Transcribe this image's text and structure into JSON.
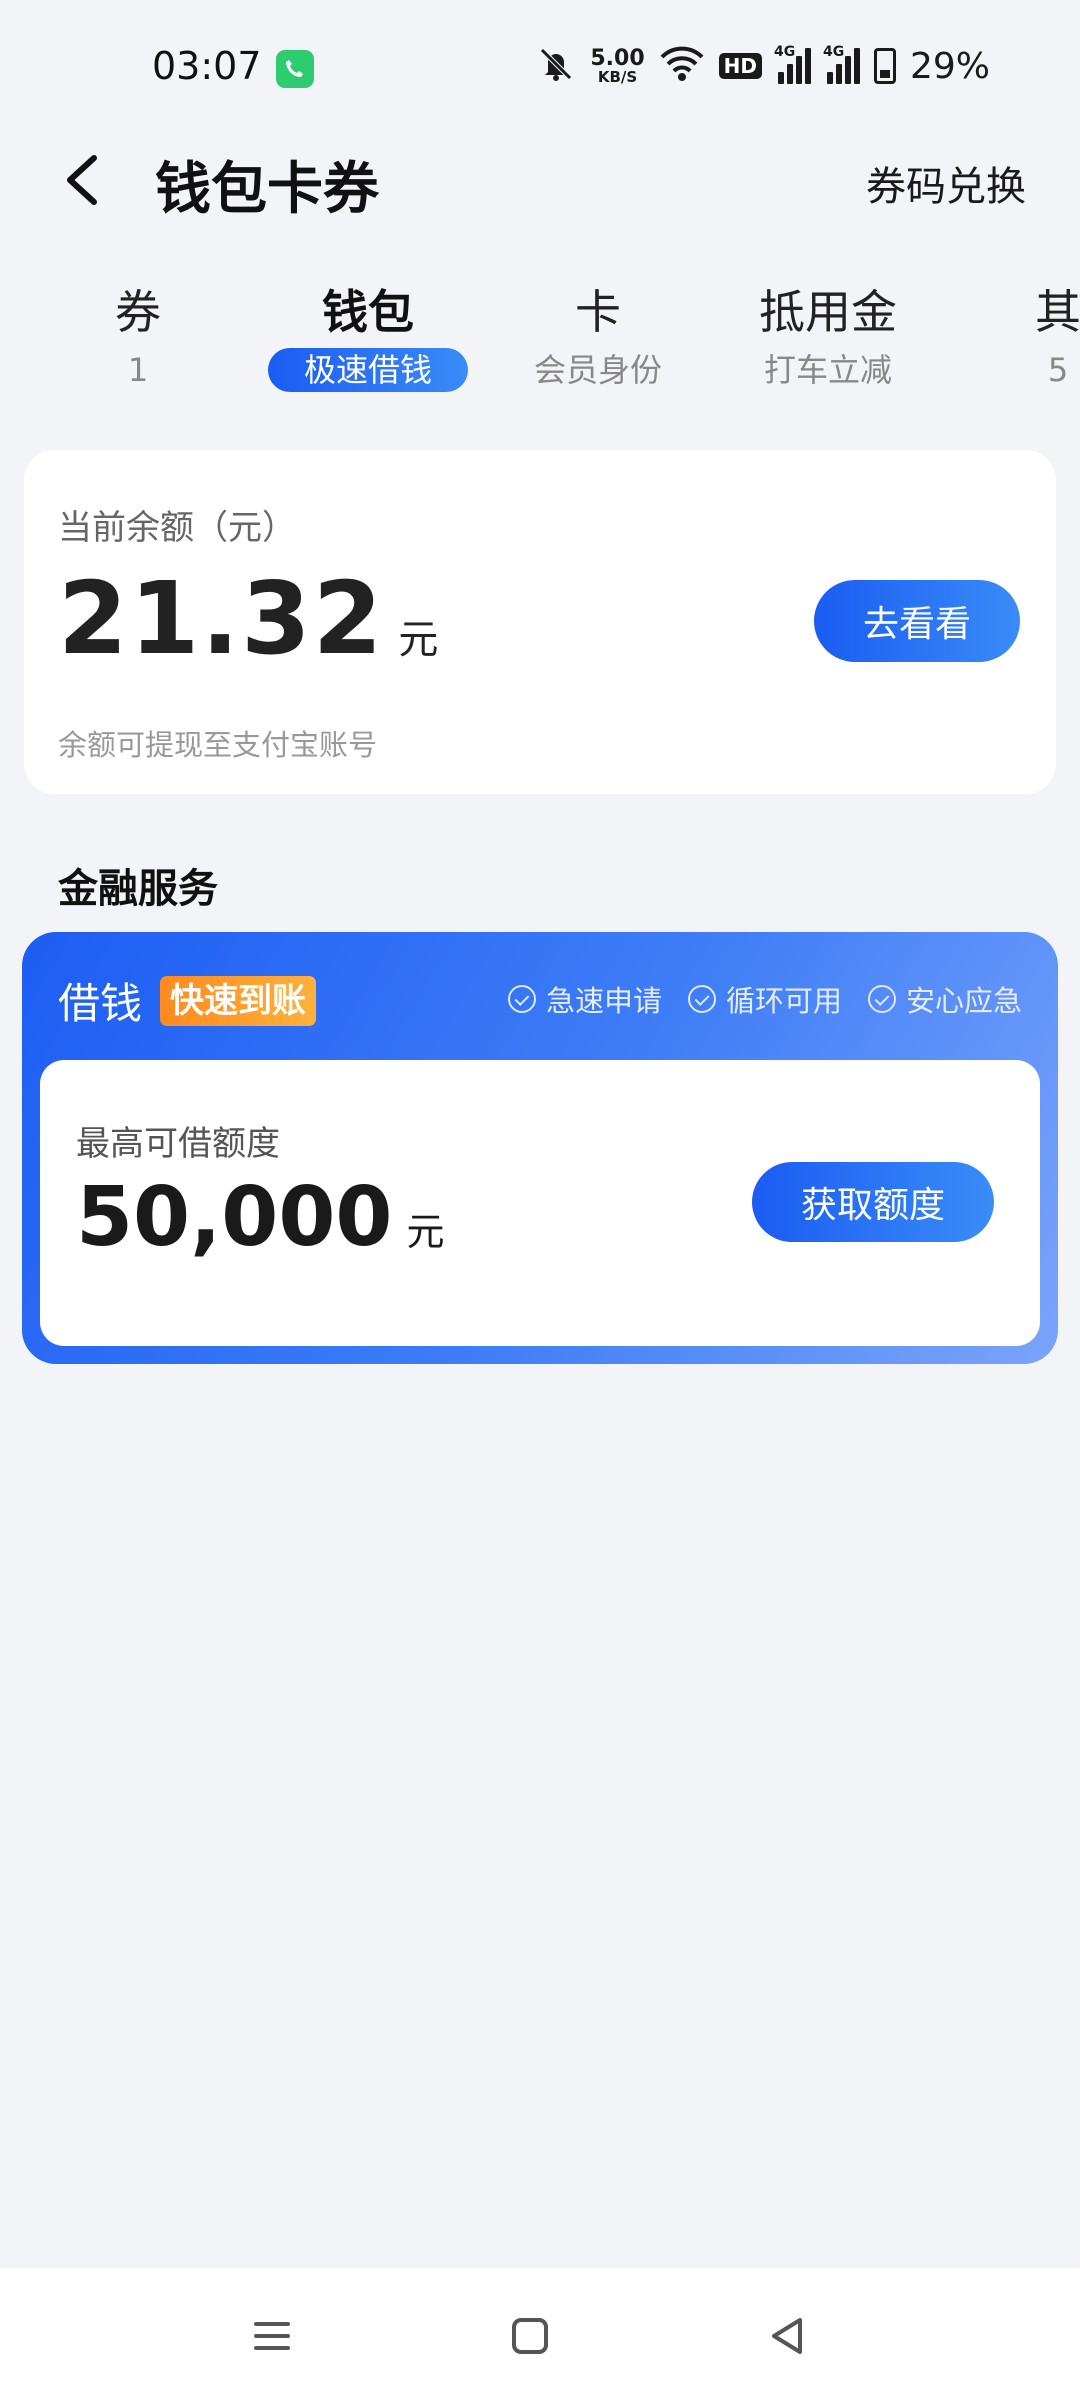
{
  "status_bar": {
    "time": "03:07",
    "net_speed_value": "5.00",
    "net_speed_unit": "KB/S",
    "hd_label": "HD",
    "signal1_label": "4G",
    "signal2_label": "4G",
    "battery_percent": "29%",
    "icons": [
      "phone-call-icon",
      "mute-icon",
      "wifi-icon",
      "signal-icon",
      "battery-icon"
    ]
  },
  "header": {
    "title": "钱包卡券",
    "right_link": "券码兑换"
  },
  "tabs": [
    {
      "title": "券",
      "sub": "1",
      "active": false
    },
    {
      "title": "钱包",
      "sub": "极速借钱",
      "active": true
    },
    {
      "title": "卡",
      "sub": "会员身份",
      "active": false
    },
    {
      "title": "抵用金",
      "sub": "打车立减",
      "active": false
    },
    {
      "title": "其",
      "sub": "5",
      "active": false
    }
  ],
  "balance": {
    "label": "当前余额（元）",
    "amount": "21.32",
    "unit": "元",
    "button": "去看看",
    "note": "余额可提现至支付宝账号"
  },
  "section": {
    "title": "金融服务"
  },
  "loan": {
    "title": "借钱",
    "tag": "快速到账",
    "features": [
      "急速申请",
      "循环可用",
      "安心应急"
    ],
    "label": "最高可借额度",
    "amount": "50,000",
    "unit": "元",
    "button": "获取额度"
  },
  "colors": {
    "accent": "#1b5cf2",
    "tag_orange": "#ff9a2a",
    "background": "#f3f4f7"
  }
}
